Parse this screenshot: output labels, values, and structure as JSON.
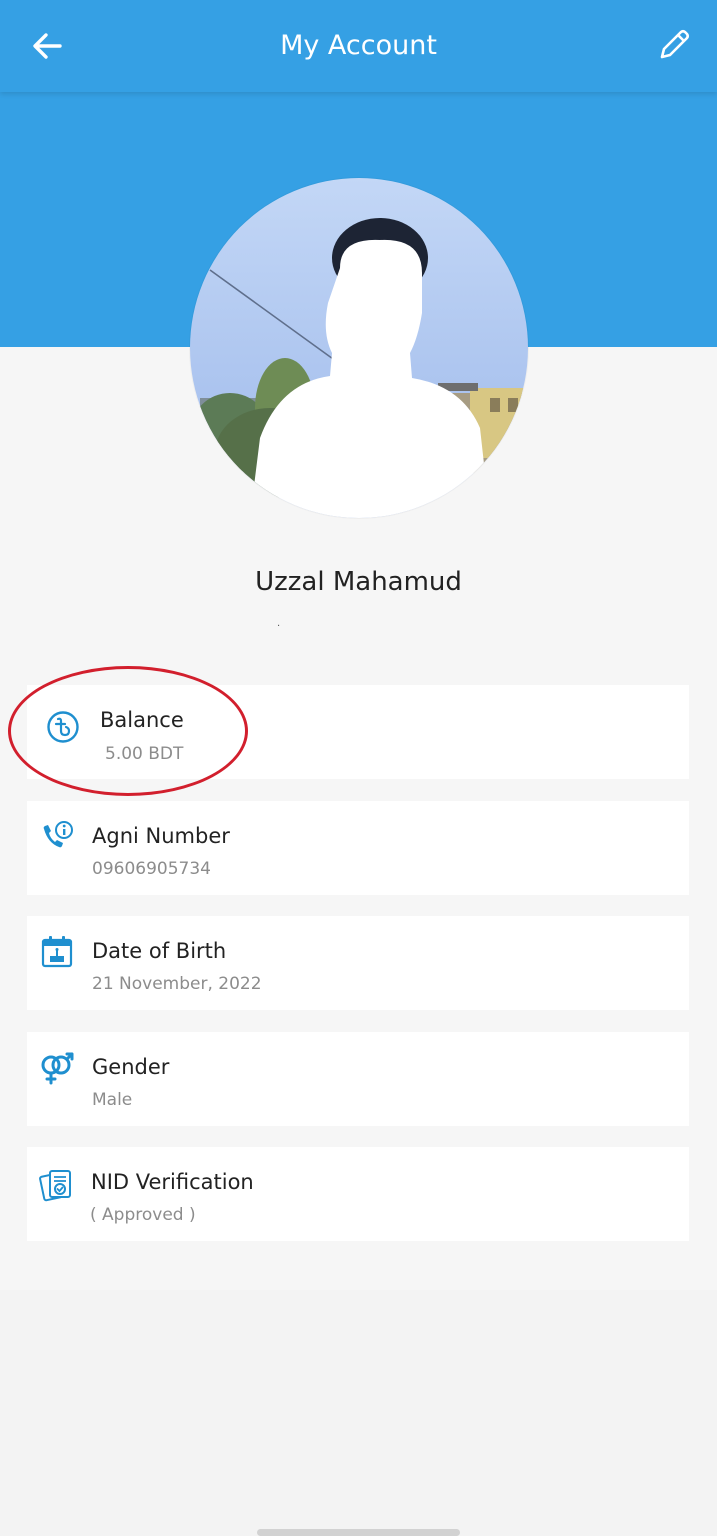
{
  "header": {
    "title": "My Account",
    "back_icon": "arrow-left-icon",
    "edit_icon": "pencil-icon",
    "background_color": "#35a0e4"
  },
  "profile": {
    "name": "Uzzal Mahamud",
    "subtitle": "."
  },
  "items": [
    {
      "icon": "taka-coin-icon",
      "label": "Balance",
      "value": "5.00 BDT"
    },
    {
      "icon": "phone-info-icon",
      "label": "Agni Number",
      "value": "09606905734"
    },
    {
      "icon": "calendar-icon",
      "label": "Date of Birth",
      "value": "21 November, 2022"
    },
    {
      "icon": "gender-icon",
      "label": "Gender",
      "value": "Male"
    },
    {
      "icon": "id-card-verified-icon",
      "label": "NID Verification",
      "value": "( Approved )"
    }
  ],
  "annotation_color": "#d21f2d",
  "icon_color": "#1f8fcf"
}
